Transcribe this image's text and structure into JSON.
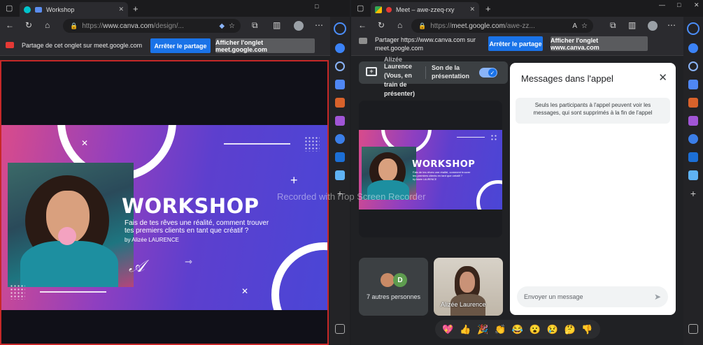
{
  "left_window": {
    "tab_title": "Workshop",
    "url_prefix": "https://",
    "url_host": "www.canva.com",
    "url_path": "/design/...",
    "share_message": "Partage de cet onglet sur meet.google.com",
    "stop_share_label": "Arrêter le partage",
    "show_tab_label": "Afficher l'onglet meet.google.com"
  },
  "slide": {
    "title": "WORKSHOP",
    "subtitle_line1": "Fais de tes rêves une réalité, comment trouver",
    "subtitle_line2": "tes premiers clients en tant que créatif ?",
    "author": "by Alizée LAURENCE"
  },
  "watermark": "Recorded with iTop Screen Recorder",
  "right_window": {
    "tab_title": "Meet – awe-zzeq-rxy",
    "url_prefix": "https://",
    "url_host": "meet.google.com",
    "url_path": "/awe-zz...",
    "share_message_line1": "Partager https://www.canva.com sur",
    "share_message_line2": "meet.google.com",
    "stop_share_label": "Arrêter le partage",
    "show_tab_label": "Afficher l'onglet www.canva.com"
  },
  "meet": {
    "presenter_line0": "Alizée",
    "presenter_line1": "Laurence",
    "presenter_line2": "(Vous, en",
    "presenter_line3": "train de",
    "presenter_line4": "présenter)",
    "sound_line1": "Son de la",
    "sound_line2": "présentation",
    "others_label": "7 autres personnes",
    "others_avatar_letter": "D",
    "self_label": "Alizée Laurence",
    "chat_title": "Messages dans l'appel",
    "chat_info_line1": "Seuls les participants à l'appel peuvent voir les",
    "chat_info_line2": "messages, qui sont supprimés à la fin de l'appel",
    "chat_placeholder": "Envoyer un message",
    "reactions": [
      "💖",
      "👍",
      "🎉",
      "👏",
      "😂",
      "😮",
      "😢",
      "🤔",
      "👎"
    ]
  },
  "colors": {
    "accent_blue": "#1a73e8",
    "share_red": "#c62828",
    "slide_pink": "#d94b8b",
    "slide_blue": "#4a46d6"
  }
}
